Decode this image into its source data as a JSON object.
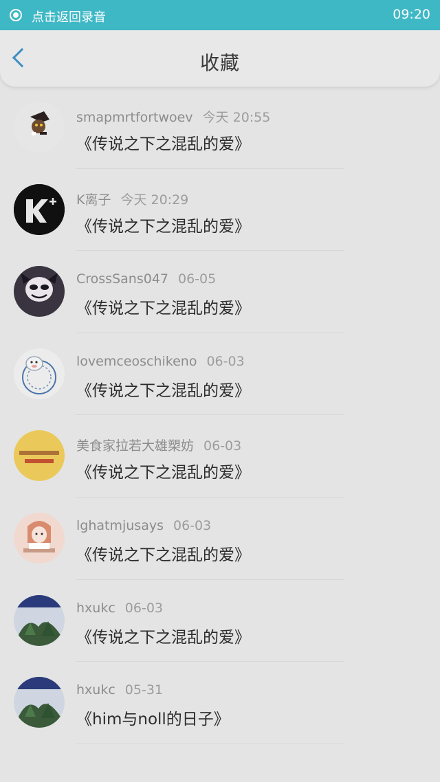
{
  "status_bar": {
    "record_text": "点击返回录音",
    "time": "09:20"
  },
  "header": {
    "title": "收藏"
  },
  "items": [
    {
      "user": "smapmrtfortwoev",
      "time": "今天 20:55",
      "work": "《传说之下之混乱的爱》"
    },
    {
      "user": "K离子",
      "time": "今天 20:29",
      "work": "《传说之下之混乱的爱》"
    },
    {
      "user": "CrossSans047",
      "time": "06-05",
      "work": "《传说之下之混乱的爱》"
    },
    {
      "user": "lovemceoschikeno",
      "time": "06-03",
      "work": "《传说之下之混乱的爱》"
    },
    {
      "user": "美食家拉若大雄槊妨",
      "time": "06-03",
      "work": "《传说之下之混乱的爱》"
    },
    {
      "user": "lghatmjusays",
      "time": "06-03",
      "work": "《传说之下之混乱的爱》"
    },
    {
      "user": "hxukc",
      "time": "06-03",
      "work": "《传说之下之混乱的爱》"
    },
    {
      "user": "hxukc",
      "time": "05-31",
      "work": "《him与noll的日子》"
    }
  ]
}
